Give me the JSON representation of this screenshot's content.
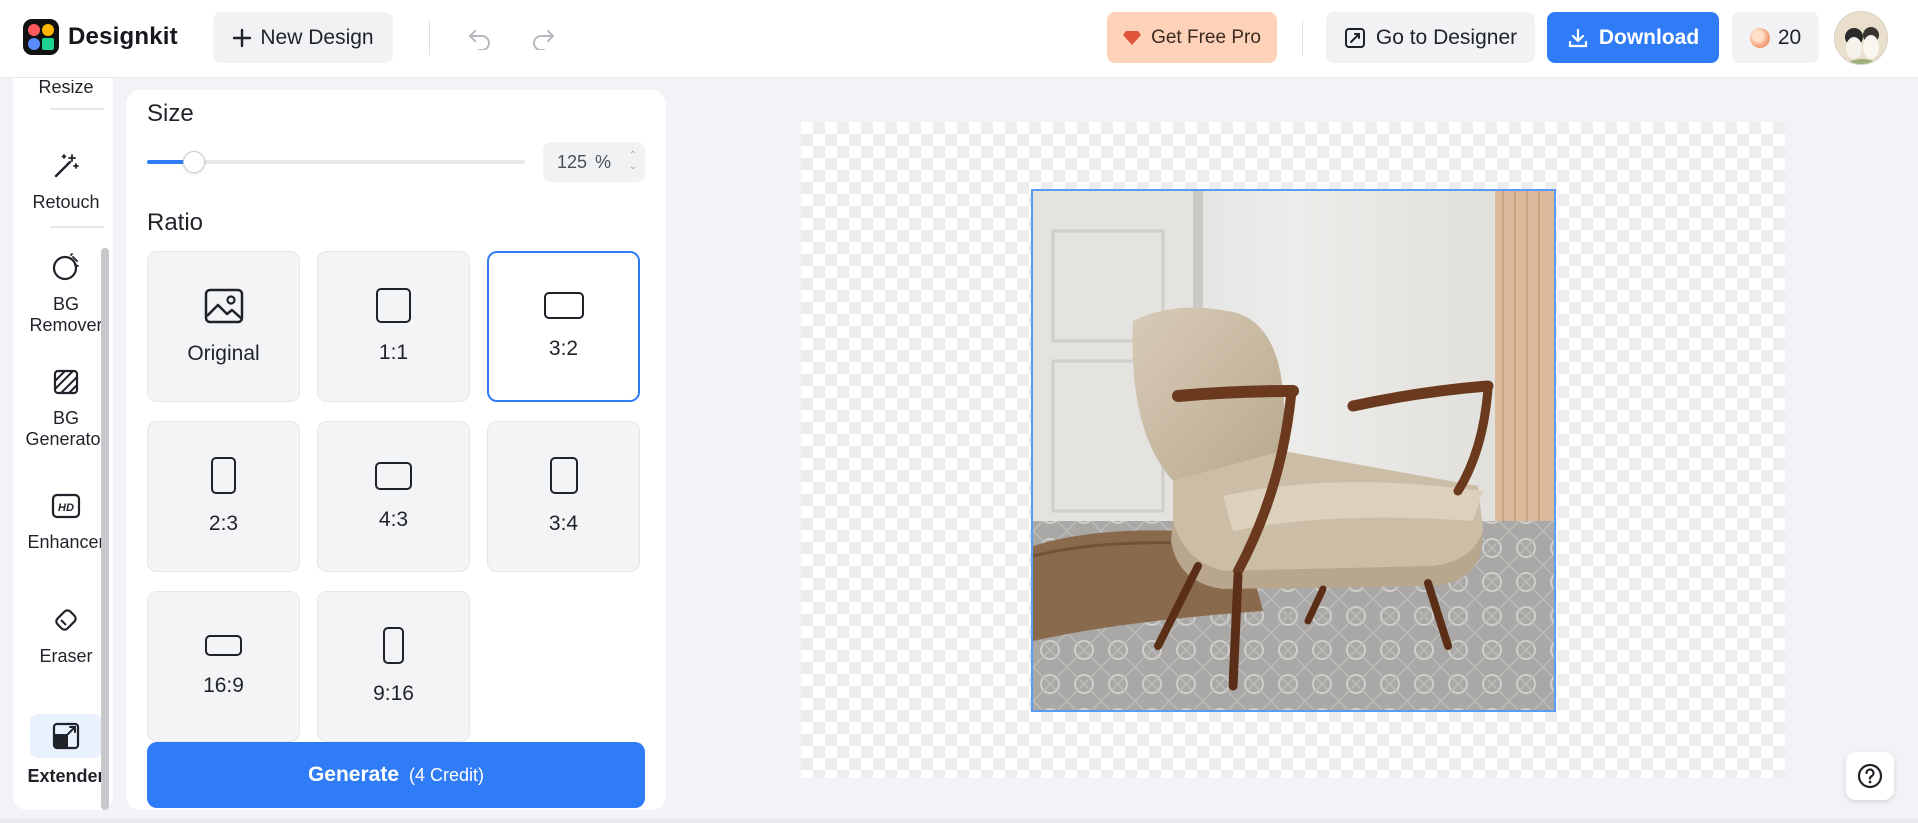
{
  "header": {
    "app_name": "Designkit",
    "new_design_label": "New Design",
    "get_pro_label": "Get Free Pro",
    "go_to_designer_label": "Go to Designer",
    "download_label": "Download",
    "credits_count": "20"
  },
  "rail": {
    "items": [
      {
        "label": "Resize",
        "icon": "resize-icon"
      },
      {
        "label": "Retouch",
        "icon": "magic-wand-icon"
      },
      {
        "label": "BG Remover",
        "icon": "bg-remover-icon"
      },
      {
        "label": "BG Generator",
        "icon": "bg-generator-icon"
      },
      {
        "label": "Enhancer",
        "icon": "hd-icon"
      },
      {
        "label": "Eraser",
        "icon": "eraser-icon"
      },
      {
        "label": "Extender",
        "icon": "extender-icon"
      }
    ],
    "active": "Extender"
  },
  "panel": {
    "size_title": "Size",
    "size_value": "125",
    "size_unit": "%",
    "size_fraction": 0.125,
    "ratio_title": "Ratio",
    "ratios": [
      {
        "label": "Original"
      },
      {
        "label": "1:1"
      },
      {
        "label": "3:2"
      },
      {
        "label": "2:3"
      },
      {
        "label": "4:3"
      },
      {
        "label": "3:4"
      },
      {
        "label": "16:9"
      },
      {
        "label": "9:16"
      }
    ],
    "selected_ratio": "3:2",
    "generate_label": "Generate",
    "generate_cost": "(4 Credit)"
  },
  "colors": {
    "accent": "#2f7cf6",
    "pro_bg": "#fdd2b8",
    "rail_active_bg": "#eaf1fe"
  }
}
